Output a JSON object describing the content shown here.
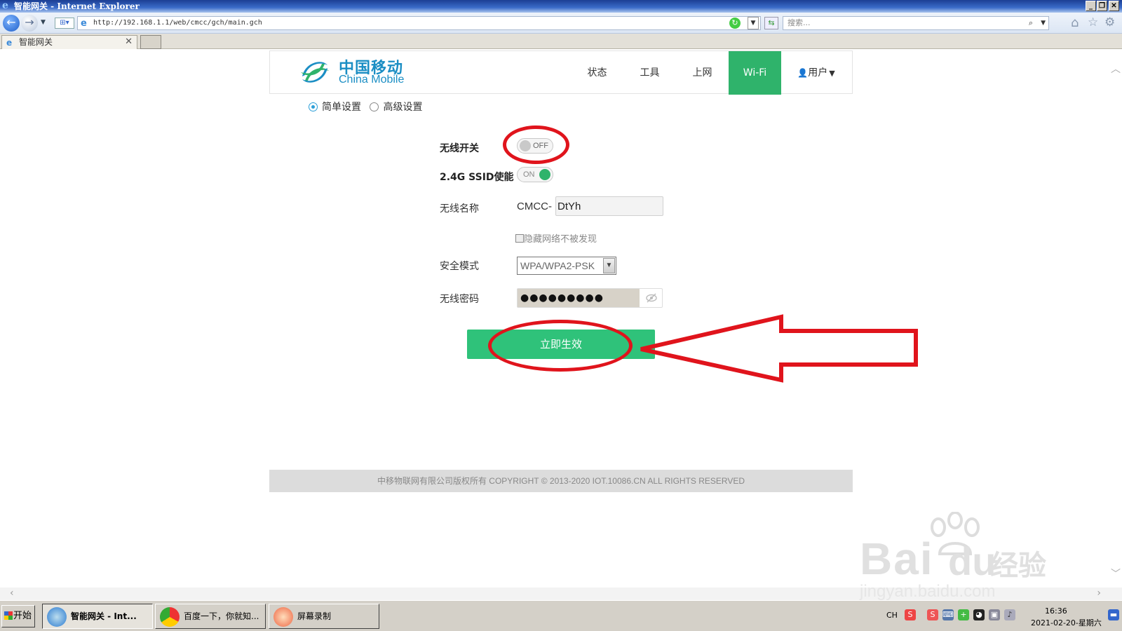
{
  "browser": {
    "title": "智能网关 - Internet Explorer",
    "url": "http://192.168.1.1/web/cmcc/gch/main.gch",
    "search_placeholder": "搜索...",
    "tab_label": "智能网关"
  },
  "header": {
    "logo_cn": "中国移动",
    "logo_en": "China Mobile",
    "nav": [
      "状态",
      "工具",
      "上网",
      "Wi-Fi",
      "用户"
    ],
    "active_nav": "Wi-Fi",
    "user_caret": "▼"
  },
  "mode": {
    "simple": "简单设置",
    "advanced": "高级设置",
    "selected": "简单设置"
  },
  "form": {
    "wireless_switch_label": "无线开关",
    "wireless_switch_state": "OFF",
    "ssid_enable_label": "2.4G SSID使能",
    "ssid_enable_state": "ON",
    "ssid_label": "无线名称",
    "ssid_prefix": "CMCC-",
    "ssid_value": "DtYh",
    "hide_network_label": "隐藏网络不被发现",
    "security_label": "安全模式",
    "security_value": "WPA/WPA2-PSK",
    "password_label": "无线密码",
    "password_value": "●●●●●●●●●",
    "apply_button": "立即生效"
  },
  "footer": {
    "copyright": "中移物联网有限公司版权所有 COPYRIGHT © 2013-2020 IOT.10086.CN ALL RIGHTS RESERVED"
  },
  "watermark": {
    "brand": "Bai",
    "brand_cn": "经验",
    "url": "jingyan.baidu.com"
  },
  "taskbar": {
    "start": "开始",
    "tasks": [
      "智能网关 - Int...",
      "百度一下，你就知...",
      "屏幕录制"
    ],
    "input_lang": "CH",
    "time": "16:36",
    "date": "2021-02-20-星期六"
  },
  "colors": {
    "brand_blue": "#1b8ec4",
    "active_green": "#2fb36b",
    "button_green": "#2fc27a",
    "annotation_red": "#e0141c"
  }
}
